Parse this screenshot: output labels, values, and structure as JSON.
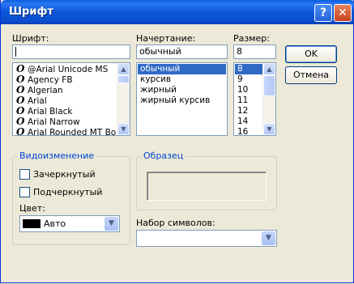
{
  "window": {
    "title": "Шрифт",
    "help_glyph": "?",
    "close_glyph": "✕"
  },
  "font": {
    "label": "Шрифт:",
    "value": "",
    "items": [
      {
        "name": "@Arial Unicode MS"
      },
      {
        "name": "Agency FB"
      },
      {
        "name": "Algerian"
      },
      {
        "name": "Arial"
      },
      {
        "name": "Arial Black"
      },
      {
        "name": "Arial Narrow"
      },
      {
        "name": "Arial Rounded MT Bold"
      }
    ],
    "icon_glyph": "O"
  },
  "style": {
    "label": "Начертание:",
    "value": "обычный",
    "items": [
      "обычный",
      "курсив",
      "жирный",
      "жирный курсив"
    ],
    "selected_index": 0
  },
  "size": {
    "label": "Размер:",
    "value": "8",
    "items": [
      "8",
      "9",
      "10",
      "11",
      "12",
      "14",
      "16"
    ],
    "selected_index": 0
  },
  "buttons": {
    "ok": "OK",
    "cancel": "Отмена"
  },
  "effects": {
    "title": "Видоизменение",
    "strikeout": "Зачеркнутый",
    "underline": "Подчеркнутый",
    "color_label": "Цвет:",
    "color_value": "Авто",
    "color_swatch": "#000000"
  },
  "sample": {
    "title": "Образец"
  },
  "script": {
    "label": "Набор символов:",
    "value": ""
  },
  "scroll": {
    "up": "▲",
    "down": "▼"
  }
}
